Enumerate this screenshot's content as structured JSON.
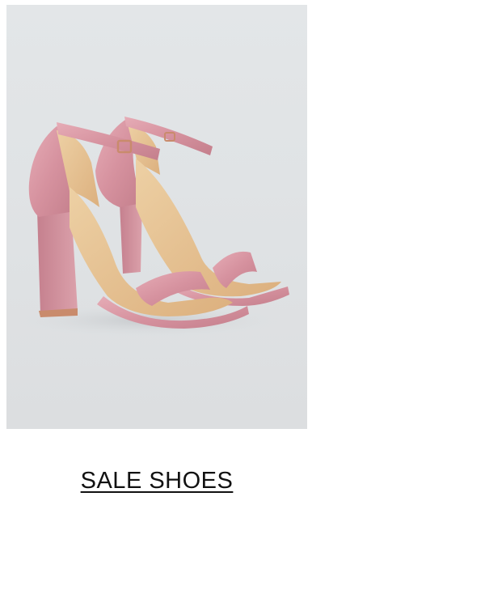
{
  "product_card": {
    "image_subject": "pink-glitter-ankle-strap-heels",
    "colors": {
      "background": "#dfe2e4",
      "glitter": "#d99aa5",
      "glitter_dark": "#b8707e",
      "lining": "#e6c293",
      "caption_text": "#111111"
    },
    "caption": "SALE SHOES"
  }
}
